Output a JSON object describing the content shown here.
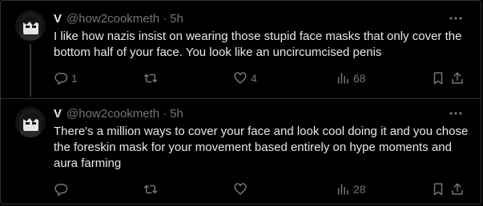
{
  "tweets": [
    {
      "author_name": "V",
      "handle": "@how2cookmeth",
      "separator": "·",
      "time": "5h",
      "text": "I like how nazis insist on wearing those stupid face masks that only cover the bottom half of your face. You look like an uncircumcised penis",
      "replies": "1",
      "retweets": "",
      "likes": "4",
      "views": "68"
    },
    {
      "author_name": "V",
      "handle": "@how2cookmeth",
      "separator": "·",
      "time": "5h",
      "text": "There's a million ways to cover your face and look cool doing it and you chose the foreskin mask for your movement based entirely on hype moments and aura farming",
      "replies": "",
      "retweets": "",
      "likes": "",
      "views": "28"
    }
  ],
  "colors": {
    "background": "#000000",
    "text": "#e7e9ea",
    "muted": "#71767b",
    "border": "#2f3336"
  },
  "icons": [
    "more-icon",
    "reply-icon",
    "retweet-icon",
    "like-icon",
    "views-icon",
    "bookmark-icon",
    "share-icon"
  ]
}
